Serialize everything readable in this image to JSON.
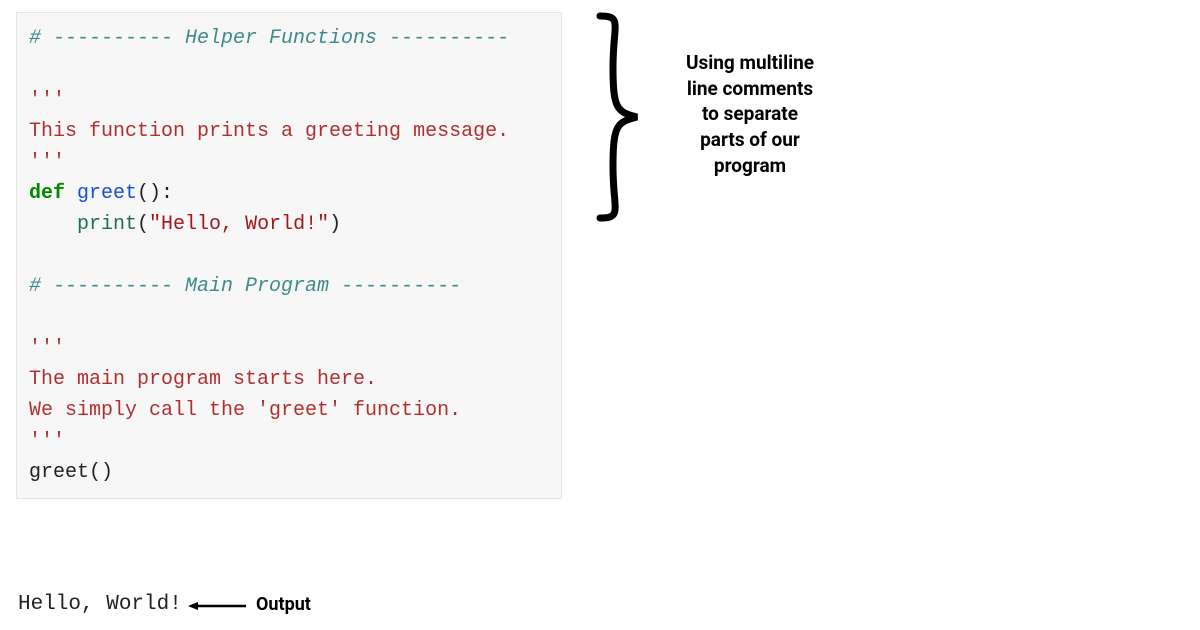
{
  "code": {
    "section1_hdr": "# ---------- Helper Functions ----------",
    "docstring1_open": "'''",
    "docstring1_body": "This function prints a greeting message.",
    "docstring1_close": "'''",
    "def_kw": "def",
    "def_name": "greet",
    "def_parens": "():",
    "print_call": "print",
    "print_open": "(",
    "print_strlit": "\"Hello, World!\"",
    "print_close": ")",
    "section2_hdr": "# ---------- Main Program ----------",
    "docstring2_open": "'''",
    "docstring2_line1": "The main program starts here.",
    "docstring2_line2": "We simply call the 'greet' function.",
    "docstring2_close": "'''",
    "call_name": "greet",
    "call_parens": "()"
  },
  "output": {
    "text": "Hello, World!",
    "label": "Output"
  },
  "annotation": {
    "line1": "Using multiline",
    "line2": "line comments",
    "line3": "to separate",
    "line4": "parts of our",
    "line5": "program"
  }
}
